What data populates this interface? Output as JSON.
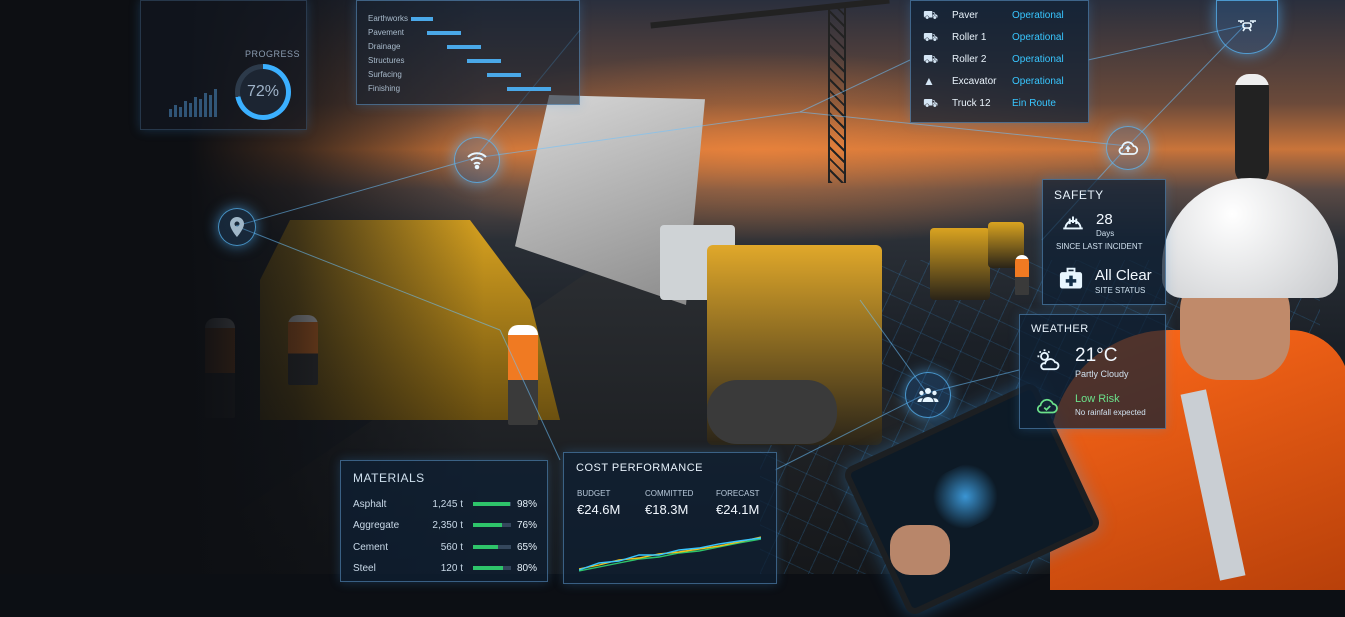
{
  "progress": {
    "label": "PROGRESS",
    "value": "72%"
  },
  "schedule": {
    "phases": [
      "Earthworks",
      "Pavement",
      "Drainage",
      "Structures",
      "Surfacing",
      "Finishing"
    ]
  },
  "equipment": [
    {
      "name": "Paver",
      "status": "Operational",
      "icon": "paver-icon"
    },
    {
      "name": "Roller 1",
      "status": "Operational",
      "icon": "roller-icon"
    },
    {
      "name": "Roller 2",
      "status": "Operational",
      "icon": "roller-icon"
    },
    {
      "name": "Excavator",
      "status": "Operational",
      "icon": "excavator-icon"
    },
    {
      "name": "Truck 12",
      "status": "Ein Route",
      "icon": "truck-icon"
    }
  ],
  "safety": {
    "title": "SAFETY",
    "days_value": "28",
    "days_unit": "Days",
    "days_caption": "SINCE LAST INCIDENT",
    "status_value": "All Clear",
    "status_caption": "SITE STATUS"
  },
  "weather": {
    "title": "WEATHER",
    "temperature": "21°C",
    "condition": "Partly Cloudy",
    "risk": "Low Risk",
    "risk_caption": "No rainfall expected"
  },
  "materials": {
    "title": "MATERIALS",
    "rows": [
      {
        "name": "Asphalt",
        "qty": "1,245 t",
        "pct_label": "98%",
        "pct": 0.98
      },
      {
        "name": "Aggregate",
        "qty": "2,350 t",
        "pct_label": "76%",
        "pct": 0.76
      },
      {
        "name": "Cement",
        "qty": "560 t",
        "pct_label": "65%",
        "pct": 0.65
      },
      {
        "name": "Steel",
        "qty": "120 t",
        "pct_label": "80%",
        "pct": 0.8
      }
    ]
  },
  "cost": {
    "title": "COST PERFORMANCE",
    "budget_label": "BUDGET",
    "budget": "€24.6M",
    "committed_label": "COMMITTED",
    "committed": "€18.3M",
    "forecast_label": "FORECAST",
    "forecast": "€24.1M"
  },
  "colors": {
    "accent": "#38c6ff",
    "ok": "#2ec46a",
    "risk_ok": "#6be08a",
    "vest": "#ff6a1a"
  }
}
